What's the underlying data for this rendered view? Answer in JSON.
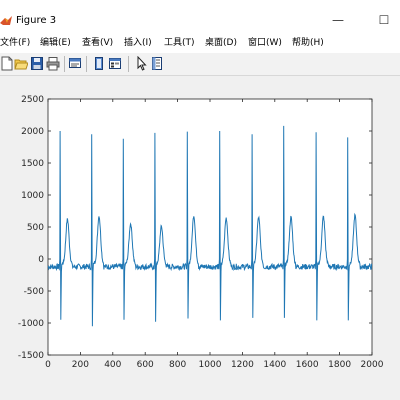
{
  "window": {
    "title": "Figure 3",
    "controls": [
      "—",
      "☐"
    ]
  },
  "menu": [
    "文件(F)",
    "编辑(E)",
    "查看(V)",
    "插入(I)",
    "工具(T)",
    "桌面(D)",
    "窗口(W)",
    "帮助(H)"
  ],
  "toolbar": [
    "new-figure-icon",
    "open-file-icon",
    "save-icon",
    "print-icon",
    "print-preview-icon",
    "dock-figure-icon",
    "insert-colorbar-icon",
    "edit-plot-arrow-icon",
    "property-inspector-icon"
  ],
  "colors": {
    "line": "#1f77b4",
    "axes_bg": "#ffffff",
    "figure_bg": "#f0f0f0"
  },
  "chart_data": {
    "type": "line",
    "title": "",
    "xlabel": "",
    "ylabel": "",
    "xlim": [
      0,
      2000
    ],
    "ylim": [
      -1500,
      2500
    ],
    "xticks": [
      0,
      200,
      400,
      600,
      800,
      1000,
      1200,
      1400,
      1600,
      1800,
      2000
    ],
    "yticks": [
      -1500,
      -1000,
      -500,
      0,
      500,
      1000,
      1500,
      2000,
      2500
    ],
    "grid": false,
    "series": [
      {
        "name": "",
        "baseline": -120,
        "beats": [
          {
            "r_x": 75,
            "r_peak": 2000,
            "s_min": -950,
            "t_x": 120,
            "t_peak": 620
          },
          {
            "r_x": 270,
            "r_peak": 1950,
            "s_min": -1050,
            "t_x": 315,
            "t_peak": 670
          },
          {
            "r_x": 465,
            "r_peak": 1880,
            "s_min": -950,
            "t_x": 510,
            "t_peak": 550
          },
          {
            "r_x": 660,
            "r_peak": 1970,
            "s_min": -980,
            "t_x": 700,
            "t_peak": 510
          },
          {
            "r_x": 860,
            "r_peak": 1990,
            "s_min": -930,
            "t_x": 900,
            "t_peak": 680
          },
          {
            "r_x": 1060,
            "r_peak": 2000,
            "s_min": -960,
            "t_x": 1100,
            "t_peak": 640
          },
          {
            "r_x": 1260,
            "r_peak": 1950,
            "s_min": -920,
            "t_x": 1300,
            "t_peak": 650
          },
          {
            "r_x": 1455,
            "r_peak": 2080,
            "s_min": -920,
            "t_x": 1500,
            "t_peak": 650
          },
          {
            "r_x": 1655,
            "r_peak": 1980,
            "s_min": -960,
            "t_x": 1700,
            "t_peak": 660
          },
          {
            "r_x": 1850,
            "r_peak": 1900,
            "s_min": -960,
            "t_x": 1895,
            "t_peak": 680
          }
        ]
      }
    ]
  }
}
